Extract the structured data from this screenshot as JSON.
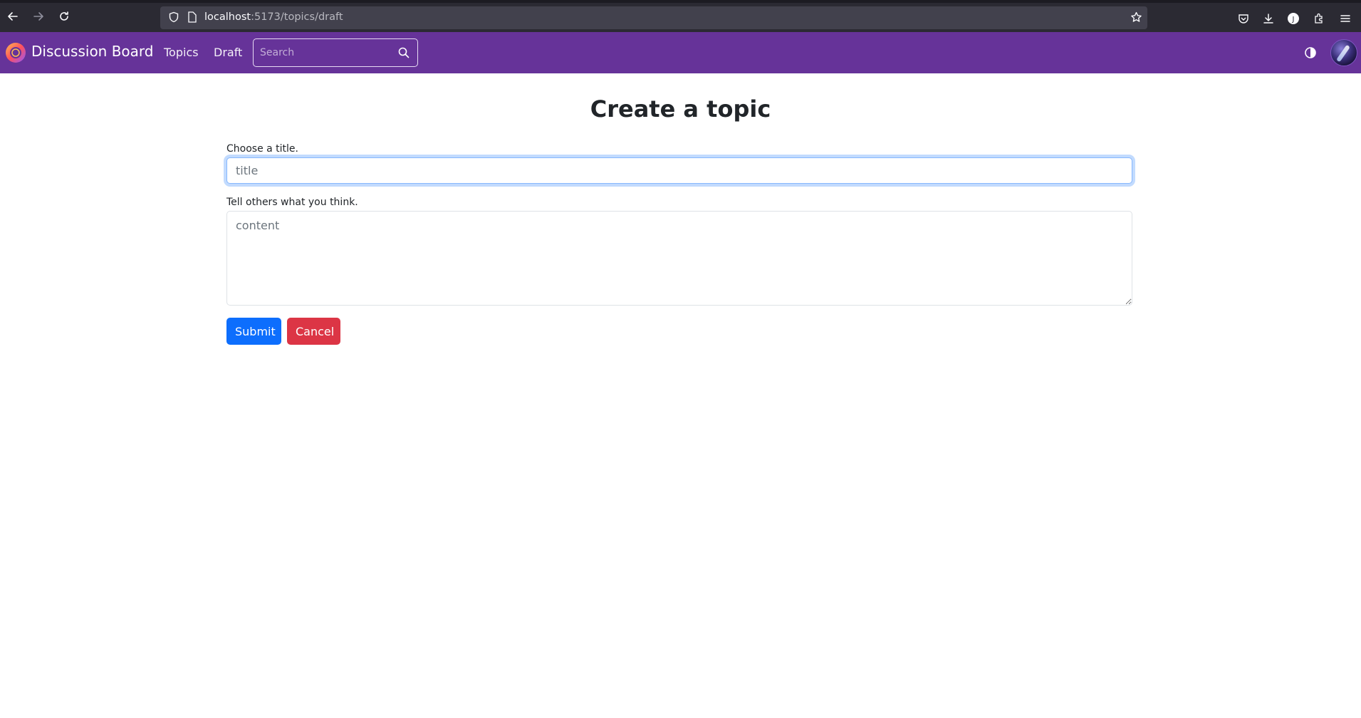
{
  "browser": {
    "url_host": "localhost",
    "url_path": ":5173/topics/draft"
  },
  "navbar": {
    "brand": "Discussion Board",
    "links": [
      "Topics",
      "Draft"
    ],
    "search_placeholder": "Search",
    "accent_color": "#663399"
  },
  "form": {
    "heading": "Create a topic",
    "title_label": "Choose a title.",
    "title_placeholder": "title",
    "content_label": "Tell others what you think.",
    "content_placeholder": "content",
    "submit_label": "Submit",
    "cancel_label": "Cancel",
    "submit_color": "#0d6efd",
    "cancel_color": "#dc3545"
  }
}
